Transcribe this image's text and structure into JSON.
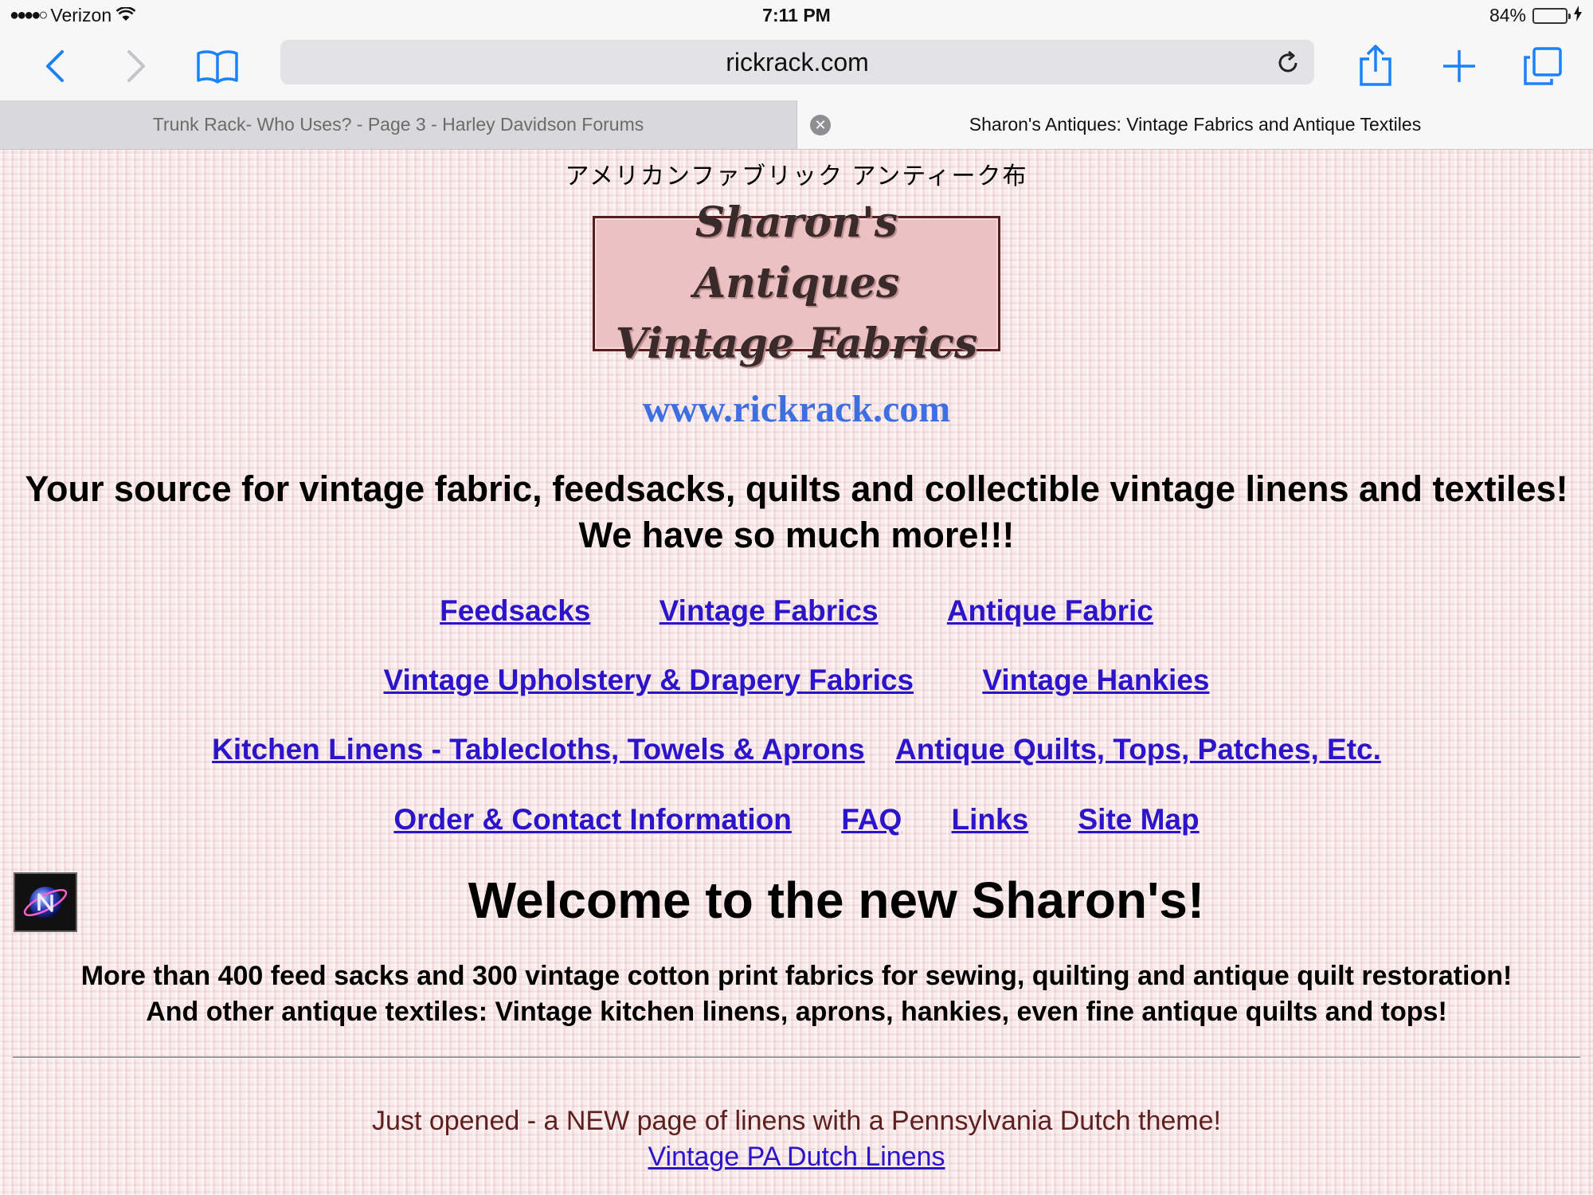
{
  "status_bar": {
    "carrier": "Verizon",
    "time": "7:11 PM",
    "battery_percent_label": "84%",
    "battery_level": 0.84
  },
  "toolbar": {
    "url": "rickrack.com",
    "icons": [
      "back-icon",
      "forward-icon",
      "bookmarks-icon",
      "reload-icon",
      "share-icon",
      "new-tab-icon",
      "tabs-icon"
    ]
  },
  "tabs": [
    {
      "title": "Trunk Rack- Who Uses? - Page 3 - Harley Davidson Forums",
      "active": false
    },
    {
      "title": "Sharon's Antiques: Vintage Fabrics and Antique Textiles",
      "active": true
    }
  ],
  "page": {
    "japanese_line": "アメリカンファブリック アンティーク布",
    "logo": {
      "line1": "Sharon's Antiques",
      "line2": "Vintage Fabrics"
    },
    "site_url": "www.rickrack.com",
    "tagline": "Your source for vintage fabric, feedsacks, quilts and collectible vintage linens and textiles! We have so much more!!!",
    "nav": {
      "row1": [
        "Feedsacks",
        "Vintage Fabrics",
        "Antique Fabric"
      ],
      "row2": [
        "Vintage Upholstery & Drapery Fabrics",
        "Vintage Hankies"
      ],
      "row3": [
        "Kitchen Linens - Tablecloths, Towels & Aprons",
        "Antique Quilts, Tops, Patches, Etc."
      ],
      "row4": [
        "Order & Contact Information",
        "FAQ",
        "Links",
        "Site Map"
      ]
    },
    "welcome": "Welcome to the new Sharon's!",
    "intro_line1": "More than 400 feed sacks and 300 vintage cotton print fabrics for sewing, quilting and antique quilt restoration!",
    "intro_line2": "And other antique textiles: Vintage kitchen linens, aprons, hankies, even fine antique quilts and tops!",
    "announcement": "Just opened - a NEW page of linens with a Pennsylvania Dutch theme!",
    "announcement_link": "Vintage PA Dutch Linens"
  },
  "colors": {
    "link": "#2b14c9",
    "site_url": "#3e6fe0",
    "ios_blue": "#1a82fb",
    "logo_bg": "#ebc1c3",
    "logo_border": "#5a1d1d",
    "announcement": "#5e1f1f",
    "battery_fill": "#4cd964"
  }
}
